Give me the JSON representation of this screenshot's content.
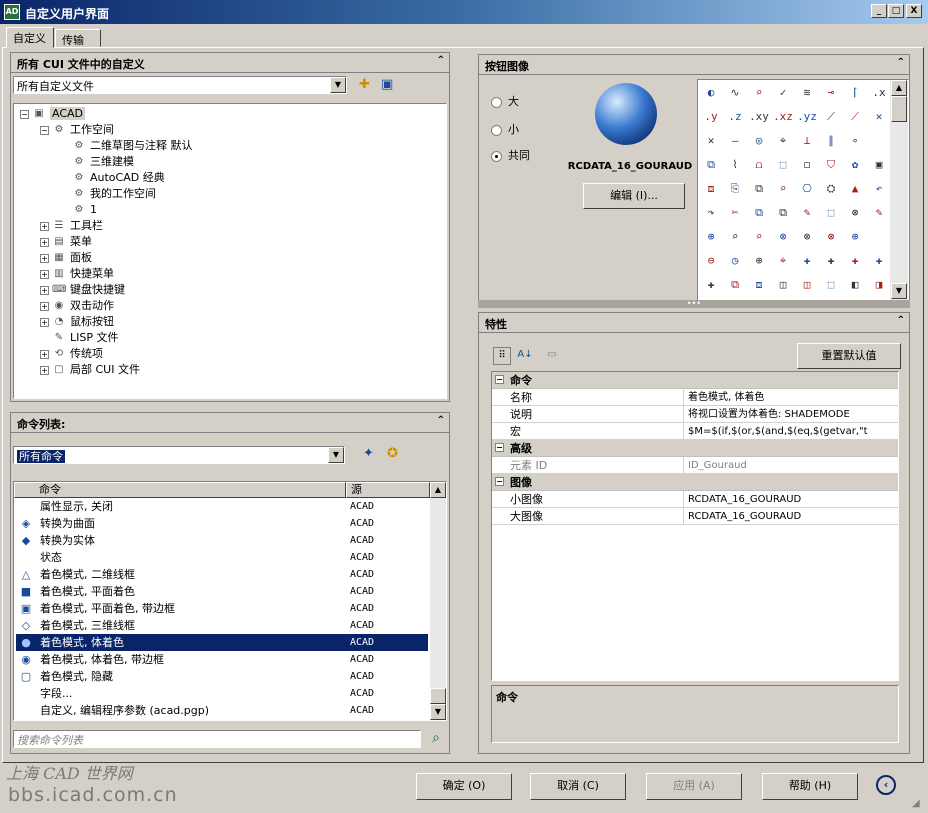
{
  "window": {
    "title": "自定义用户界面",
    "min": "_",
    "max": "□",
    "close": "X",
    "app_icon": "AD"
  },
  "tabs": [
    {
      "label": "自定义"
    },
    {
      "label": "传输"
    }
  ],
  "cui_panel": {
    "title": "所有 CUI 文件中的自定义",
    "filter_value": "所有自定义文件",
    "tree": [
      {
        "label": "ACAD",
        "level": 0,
        "exp": "−",
        "icon": "cad-file-icon",
        "glyph": "▣"
      },
      {
        "label": "工作空间",
        "level": 1,
        "exp": "−",
        "icon": "gear-icon",
        "glyph": "⚙"
      },
      {
        "label": "二维草图与注释 默认",
        "level": 2,
        "exp": "",
        "icon": "gear-icon",
        "glyph": "⚙"
      },
      {
        "label": "三维建模",
        "level": 2,
        "exp": "",
        "icon": "gear-icon",
        "glyph": "⚙"
      },
      {
        "label": "AutoCAD 经典",
        "level": 2,
        "exp": "",
        "icon": "gear-icon",
        "glyph": "⚙"
      },
      {
        "label": "我的工作空间",
        "level": 2,
        "exp": "",
        "icon": "gear-icon",
        "glyph": "⚙"
      },
      {
        "label": "1",
        "level": 2,
        "exp": "",
        "icon": "gear-icon",
        "glyph": "⚙"
      },
      {
        "label": "工具栏",
        "level": 1,
        "exp": "+",
        "icon": "toolbar-icon",
        "glyph": "☰"
      },
      {
        "label": "菜单",
        "level": 1,
        "exp": "+",
        "icon": "menu-icon",
        "glyph": "▤"
      },
      {
        "label": "面板",
        "level": 1,
        "exp": "+",
        "icon": "panel-icon",
        "glyph": "▦"
      },
      {
        "label": "快捷菜单",
        "level": 1,
        "exp": "+",
        "icon": "shortcut-menu-icon",
        "glyph": "▥"
      },
      {
        "label": "键盘快捷键",
        "level": 1,
        "exp": "+",
        "icon": "keyboard-icon",
        "glyph": "⌨"
      },
      {
        "label": "双击动作",
        "level": 1,
        "exp": "+",
        "icon": "double-click-icon",
        "glyph": "◉"
      },
      {
        "label": "鼠标按钮",
        "level": 1,
        "exp": "+",
        "icon": "mouse-icon",
        "glyph": "◔"
      },
      {
        "label": "LISP 文件",
        "level": 1,
        "exp": "",
        "icon": "lisp-file-icon",
        "glyph": "✎"
      },
      {
        "label": "传统项",
        "level": 1,
        "exp": "+",
        "icon": "legacy-icon",
        "glyph": "⟲"
      },
      {
        "label": "局部 CUI 文件",
        "level": 1,
        "exp": "+",
        "icon": "partial-cui-icon",
        "glyph": "▢"
      }
    ]
  },
  "cmd_panel": {
    "title": "命令列表:",
    "filter_value": "所有命令",
    "col_command": "命令",
    "col_source": "源",
    "search_placeholder": "搜索命令列表",
    "rows": [
      {
        "name": "属性显示, 关闭",
        "src": "ACAD",
        "icon": "",
        "glyph": ""
      },
      {
        "name": "转换为曲面",
        "src": "ACAD",
        "icon": "convert-surface-icon",
        "glyph": "◈"
      },
      {
        "name": "转换为实体",
        "src": "ACAD",
        "icon": "convert-solid-icon",
        "glyph": "◆"
      },
      {
        "name": "状态",
        "src": "ACAD",
        "icon": "",
        "glyph": ""
      },
      {
        "name": "着色模式, 二维线框",
        "src": "ACAD",
        "icon": "2d-wireframe-icon",
        "glyph": "△"
      },
      {
        "name": "着色模式, 平面着色",
        "src": "ACAD",
        "icon": "flat-shaded-icon",
        "glyph": "■"
      },
      {
        "name": "着色模式, 平面着色, 带边框",
        "src": "ACAD",
        "icon": "flat-shaded-edges-icon",
        "glyph": "▣"
      },
      {
        "name": "着色模式, 三维线框",
        "src": "ACAD",
        "icon": "3d-wireframe-icon",
        "glyph": "◇"
      },
      {
        "name": "着色模式, 体着色",
        "src": "ACAD",
        "icon": "gouraud-icon",
        "glyph": "●",
        "selected": true
      },
      {
        "name": "着色模式, 体着色, 带边框",
        "src": "ACAD",
        "icon": "gouraud-edges-icon",
        "glyph": "◉"
      },
      {
        "name": "着色模式, 隐藏",
        "src": "ACAD",
        "icon": "hidden-icon",
        "glyph": "▢"
      },
      {
        "name": "字段...",
        "src": "ACAD",
        "icon": "",
        "glyph": ""
      },
      {
        "name": "自定义, 编辑程序参数 (acad.pgp)",
        "src": "ACAD",
        "icon": "",
        "glyph": ""
      }
    ]
  },
  "button_image": {
    "title": "按钮图像",
    "size_large": "大",
    "size_small": "小",
    "size_both": "共同",
    "selected_size": "共同",
    "image_name": "RCDATA_16_GOURAUD",
    "edit_label": "编辑 (I)...",
    "grid": [
      "◐",
      "∿",
      "⌕",
      "✓",
      "≋",
      "⊸",
      "⌈",
      ".x",
      ".y",
      ".z",
      ".xy",
      ".xz",
      ".yz",
      "⟋",
      "⟋",
      "✕",
      "✕",
      "—",
      "◎",
      "⌖",
      "⊥",
      "∥",
      "∘",
      "",
      "⧉",
      "⌇",
      "⩍",
      "⬚",
      "◻",
      "⛉",
      "✿",
      "▣",
      "⧈",
      "⎘",
      "⧉",
      "⌕",
      "⎔",
      "⛭",
      "▲",
      "↶",
      "↷",
      "✂",
      "⧉",
      "⧉",
      "✎",
      "⬚",
      "⊛",
      "✎",
      "⊕",
      "⌕",
      "⌕",
      "⊗",
      "⊗",
      "⊛",
      "⊕",
      "",
      "⊖",
      "◷",
      "⊕",
      "⌖",
      "✚",
      "✚",
      "✚",
      "✚",
      "✚",
      "⧉",
      "⧈",
      "◫",
      "◫",
      "⬚",
      "◧",
      "◨"
    ]
  },
  "properties": {
    "title": "特性",
    "reset_label": "重置默认值",
    "categories": [
      {
        "name": "命令",
        "rows": [
          {
            "k": "名称",
            "v": "着色模式, 体着色",
            "dim": false
          },
          {
            "k": "说明",
            "v": "将视口设置为体着色: SHADEMODE",
            "dim": false
          },
          {
            "k": "宏",
            "v": "$M=$(if,$(or,$(and,$(eq,$(getvar,\"t",
            "dim": false
          }
        ]
      },
      {
        "name": "高级",
        "rows": [
          {
            "k": "元素 ID",
            "v": "ID_Gouraud",
            "dim": true
          }
        ]
      },
      {
        "name": "图像",
        "rows": [
          {
            "k": "小图像",
            "v": "RCDATA_16_GOURAUD",
            "dim": false
          },
          {
            "k": "大图像",
            "v": "RCDATA_16_GOURAUD",
            "dim": false
          }
        ]
      }
    ],
    "description_title": "命令"
  },
  "footer": {
    "ok": "确定 (O)",
    "cancel": "取消 (C)",
    "apply": "应用 (A)",
    "help": "帮助 (H)",
    "watermark_top": "上海 CAD 世界网",
    "watermark_url": "bbs.icad.com.cn"
  },
  "colors": {
    "selection": "#0a246a",
    "title_start": "#0a246a",
    "title_end": "#a6caf0",
    "panel": "#d4d0c8"
  }
}
